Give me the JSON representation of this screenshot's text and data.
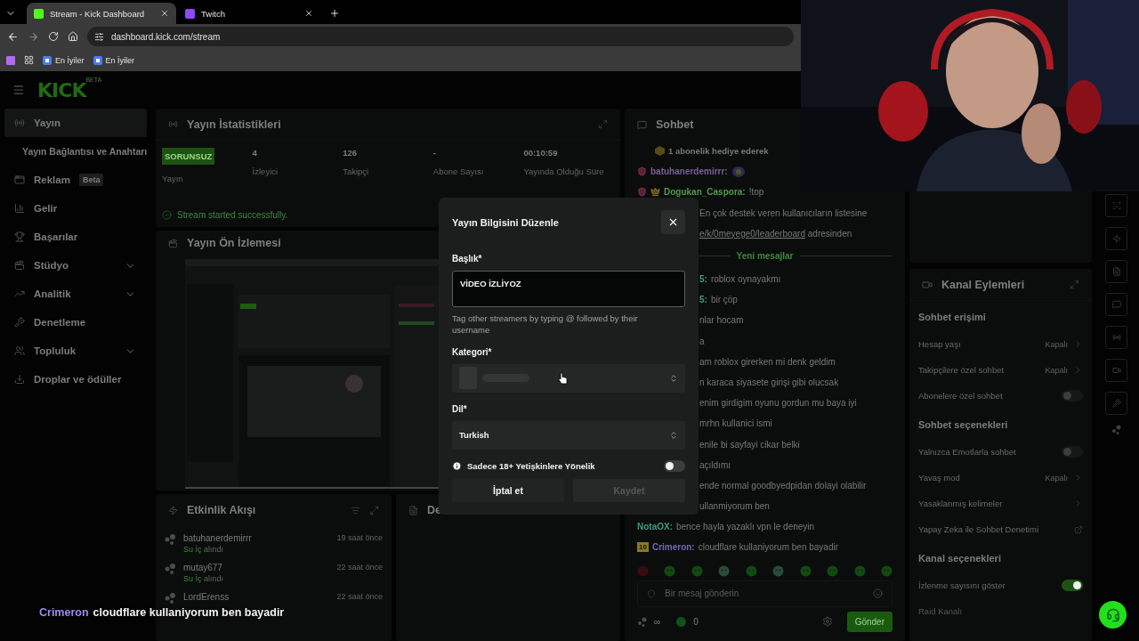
{
  "browser": {
    "tabs": [
      {
        "title": "Stream - Kick Dashboard",
        "selected": true
      },
      {
        "title": "Twitch",
        "selected": false
      }
    ],
    "url": "dashboard.kick.com/stream",
    "bookmarks": [
      "En İyiler",
      "En İyiler"
    ]
  },
  "header": {
    "logo": "KICK",
    "logo_badge": "BETA"
  },
  "sidebar": {
    "items": [
      {
        "label": "Yayın",
        "kind": "main",
        "selected": true
      },
      {
        "label": "Yayın Bağlantısı ve Anahtarı",
        "kind": "sub",
        "selected": false
      },
      {
        "label": "Reklam",
        "kind": "main",
        "selected": false,
        "badge": "Beta"
      },
      {
        "label": "Gelir",
        "kind": "main",
        "selected": false
      },
      {
        "label": "Başarılar",
        "kind": "main",
        "selected": false
      },
      {
        "label": "Stüdyo",
        "kind": "main",
        "selected": false,
        "expanded": false
      },
      {
        "label": "Analitik",
        "kind": "main",
        "selected": false,
        "expanded": false
      },
      {
        "label": "Denetleme",
        "kind": "main",
        "selected": false
      },
      {
        "label": "Topluluk",
        "kind": "main",
        "selected": false,
        "expanded": false
      },
      {
        "label": "Droplar ve ödüller",
        "kind": "main",
        "selected": false
      }
    ]
  },
  "stats_panel": {
    "title": "Yayın İstatistikleri",
    "stats": [
      {
        "kind": "badge",
        "value": "SORUNSUZ",
        "label": "Yayın"
      },
      {
        "kind": "text",
        "value": "4",
        "label": "İzleyici"
      },
      {
        "kind": "text",
        "value": "126",
        "label": "Takipçi"
      },
      {
        "kind": "text",
        "value": "-",
        "label": "Abone Sayısı"
      },
      {
        "kind": "text",
        "value": "00:10:59",
        "label": "Yayında Olduğu Süre"
      }
    ],
    "notice": "Stream started successfully."
  },
  "preview_panel": {
    "title": "Yayın Ön İzlemesi"
  },
  "activity_panel": {
    "title": "Etkinlik Akışı",
    "events": [
      {
        "user": "batuhanerdemirrr",
        "reward": "Su İç",
        "action": "alındı",
        "time": "19 saat önce"
      },
      {
        "user": "mutay677",
        "reward": "Su İç",
        "action": "alındı",
        "time": "22 saat önce"
      },
      {
        "user": "LordErenss",
        "time": "22 saat önce"
      }
    ]
  },
  "second_panel": {
    "title": "De"
  },
  "chat": {
    "title": "Sohbet",
    "messages": [
      {
        "kind": "system",
        "text": "1 abonelik hediye ederek"
      },
      {
        "kind": "message",
        "badges": [
          {
            "kind": "subscriber"
          }
        ],
        "user": "batuhanerdemirrr:",
        "color": "#7a5f9a",
        "emote": true
      },
      {
        "kind": "message",
        "badges": [
          {
            "kind": "subscriber"
          },
          {
            "kind": "crown"
          }
        ],
        "user": "Dogukan_Caspora:",
        "color": "#4f9a4a",
        "text": "!top"
      },
      {
        "kind": "fragment",
        "text": "En çok destek veren kullanıcıların listesine"
      },
      {
        "kind": "fragment",
        "link": "e/k/0meyege0/leaderboard",
        "text": "adresinden"
      },
      {
        "kind": "divider",
        "text": "Yeni mesajlar"
      },
      {
        "kind": "fragment",
        "user": "5:",
        "color": "#3f9a8a",
        "text": "roblox oynayakmı"
      },
      {
        "kind": "fragment",
        "user": "5:",
        "color": "#3f9a8a",
        "text": "bir çöp"
      },
      {
        "kind": "fragment",
        "text": "nlar hocam"
      },
      {
        "kind": "fragment",
        "text": "a"
      },
      {
        "kind": "fragment",
        "text": "am roblox girerken mi denk geldim"
      },
      {
        "kind": "fragment",
        "text": "n karaca siyasete girişi gibi olucsak"
      },
      {
        "kind": "fragment",
        "text": "enim girdigim oyunu gordun mu baya iyi"
      },
      {
        "kind": "fragment",
        "text": "mrhn kullanici ismi"
      },
      {
        "kind": "fragment",
        "text": "enile bi sayfayi cikar belki"
      },
      {
        "kind": "fragment",
        "text": "açıldımı"
      },
      {
        "kind": "fragment",
        "text": "ende normal goodbyedpidan dolayi olabilir"
      },
      {
        "kind": "fragment",
        "text": "ullanmiyorum ben"
      },
      {
        "kind": "message",
        "user": "NotaOX:",
        "color": "#3f9a7a",
        "text": "bence hayla yazaklı vpn le deneyin"
      },
      {
        "kind": "message",
        "badge": "10",
        "user": "Crimeron:",
        "color": "#6e6ab6",
        "text": "cloudflare kullaniyorum ben bayadir"
      }
    ],
    "input_placeholder": "Bir mesaj gönderin",
    "points": "∞",
    "coins": "0",
    "send": "Gönder"
  },
  "channel_actions": {
    "title": "Kanal Eylemleri",
    "sections": [
      {
        "title": "Sohbet erişimi",
        "rows": [
          {
            "kind": "select",
            "label": "Hesap yaşı",
            "value": "Kapalı"
          },
          {
            "kind": "select",
            "label": "Takipçilere özel sohbet",
            "value": "Kapalı"
          },
          {
            "kind": "toggle",
            "label": "Abonelere özel sohbet",
            "on": false
          }
        ]
      },
      {
        "title": "Sohbet seçenekleri",
        "rows": [
          {
            "kind": "toggle",
            "label": "Yalnızca Emotlarla sohbet",
            "on": false
          },
          {
            "kind": "select",
            "label": "Yavaş mod",
            "value": "Kapalı"
          },
          {
            "kind": "link",
            "label": "Yasaklanmış kelimeler"
          },
          {
            "kind": "external",
            "label": "Yapay Zeka ile Sohbet Denetimi"
          }
        ]
      },
      {
        "title": "Kanal seçenekleri",
        "rows": [
          {
            "kind": "toggle",
            "label": "İzlenme sayısını göster",
            "on": true
          },
          {
            "kind": "plain",
            "label": "Raid Kanalı"
          }
        ]
      }
    ]
  },
  "modal": {
    "title": "Yayın Bilgisini Düzenle",
    "title_label": "Başlık*",
    "title_value": "VİDEO İZLİYOZ",
    "hint": "Tag other streamers by typing @ followed by their username",
    "category_label": "Kategori*",
    "category_loading": true,
    "language_label": "Dil*",
    "language_value": "Turkish",
    "adult_label": "Sadece 18+ Yetişkinlere Yönelik",
    "adult_on": false,
    "cancel": "İptal et",
    "save": "Kaydet",
    "save_disabled": true
  },
  "caption": {
    "user": "Crimeron",
    "text": "cloudflare kullaniyorum ben bayadir"
  }
}
